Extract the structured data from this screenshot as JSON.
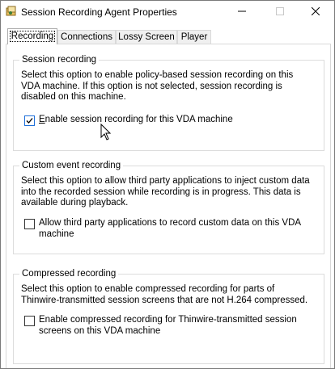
{
  "window": {
    "title": "Session Recording Agent Properties",
    "icons": {
      "app": "agent-app-icon",
      "minimize": "minimize-icon",
      "maximize": "maximize-icon",
      "close": "close-icon"
    }
  },
  "tabs": [
    {
      "label": "Recording",
      "active": true
    },
    {
      "label": "Connections",
      "active": false
    },
    {
      "label": "Lossy Screen",
      "active": false
    },
    {
      "label": "Player",
      "active": false
    }
  ],
  "groups": {
    "session_recording": {
      "title": "Session recording",
      "description": "Select this option to enable policy-based session recording on this VDA machine. If this option is not selected, session recording is disabled on this machine.",
      "checkbox_label_first": "E",
      "checkbox_label_rest": "nable session recording for this VDA machine",
      "checked": true
    },
    "custom_event": {
      "title": "Custom event recording",
      "description": "Select this option to allow third party applications to inject custom data into the recorded session while recording is in progress. This data is available during playback.",
      "checkbox_label": "Allow third party applications to record custom data on this VDA machine",
      "checked": false
    },
    "compressed": {
      "title": "Compressed recording",
      "description": "Select this option to enable compressed recording for parts of Thinwire-transmitted session screens that are not H.264 compressed.",
      "checkbox_label": "Enable compressed recording for Thinwire-transmitted session screens on this VDA machine",
      "checked": false
    }
  },
  "colors": {
    "check_accent": "#1e6fd9",
    "border": "#dcdcdc"
  }
}
